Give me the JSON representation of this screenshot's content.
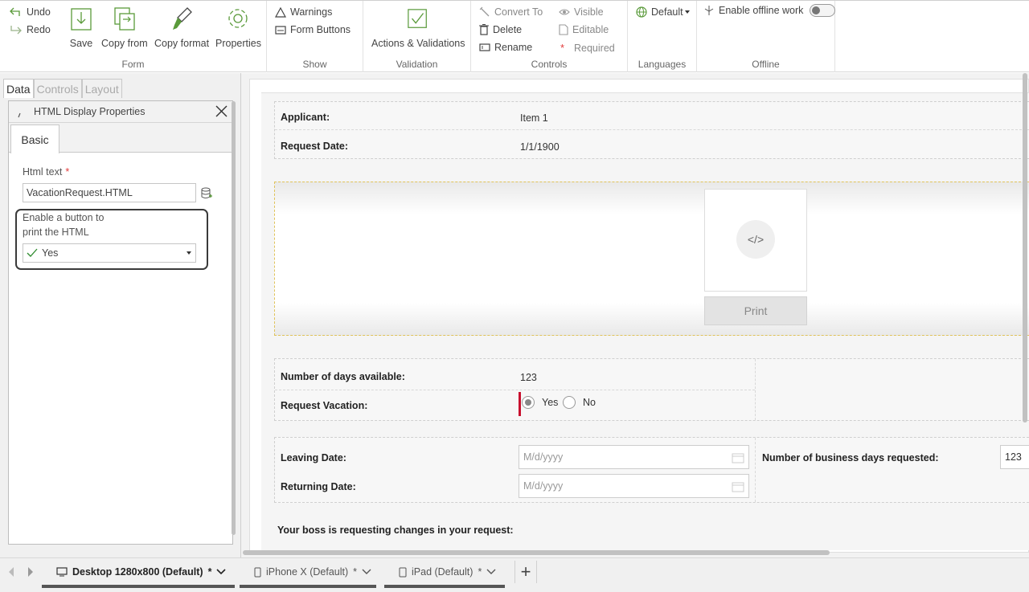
{
  "ribbon": {
    "undo": "Undo",
    "redo": "Redo",
    "save": "Save",
    "copy_from": "Copy from",
    "copy_format": "Copy format",
    "properties": "Properties",
    "group_form": "Form",
    "warnings": "Warnings",
    "form_buttons": "Form Buttons",
    "group_show": "Show",
    "actions_validations": "Actions & Validations",
    "group_validation": "Validation",
    "convert_to": "Convert To",
    "delete": "Delete",
    "rename": "Rename",
    "visible": "Visible",
    "editable": "Editable",
    "required": "Required",
    "group_controls": "Controls",
    "languages_default": "Default",
    "group_languages": "Languages",
    "offline_label": "Enable offline work",
    "group_offline": "Offline"
  },
  "left_panel": {
    "tabs": [
      "Data",
      "Controls",
      "Layout"
    ],
    "window_title": "HTML Display Properties",
    "basic_tab": "Basic",
    "html_text_label": "Html text",
    "required_mark": "*",
    "html_text_value": "VacationRequest.HTML",
    "print_label_line1": "Enable a button to",
    "print_label_line2": "print the HTML",
    "print_value": "Yes"
  },
  "form": {
    "applicant_label": "Applicant:",
    "applicant_value": "Item 1",
    "request_date_label": "Request Date:",
    "request_date_value": "1/1/1900",
    "print_button": "Print",
    "html_icon": "</>",
    "days_available_label": "Number of days available:",
    "days_available_value": "123",
    "request_vacation_label": "Request Vacation:",
    "radio_yes": "Yes",
    "radio_no": "No",
    "leaving_date_label": "Leaving Date:",
    "leaving_date_placeholder": "M/d/yyyy",
    "returning_date_label": "Returning Date:",
    "returning_date_placeholder": "M/d/yyyy",
    "business_days_label": "Number of business days requested:",
    "business_days_value": "123",
    "boss_changes_label": "Your boss is requesting changes in your request:"
  },
  "devices": {
    "desktop": "Desktop 1280x800 (Default)",
    "iphone": "iPhone X (Default)",
    "ipad": "iPad (Default)",
    "modified_mark": "*",
    "add": "+"
  },
  "colors": {
    "accent_check": "#2e8b2e",
    "required_red": "#e23b3b",
    "radio_bar": "#c8102e"
  }
}
